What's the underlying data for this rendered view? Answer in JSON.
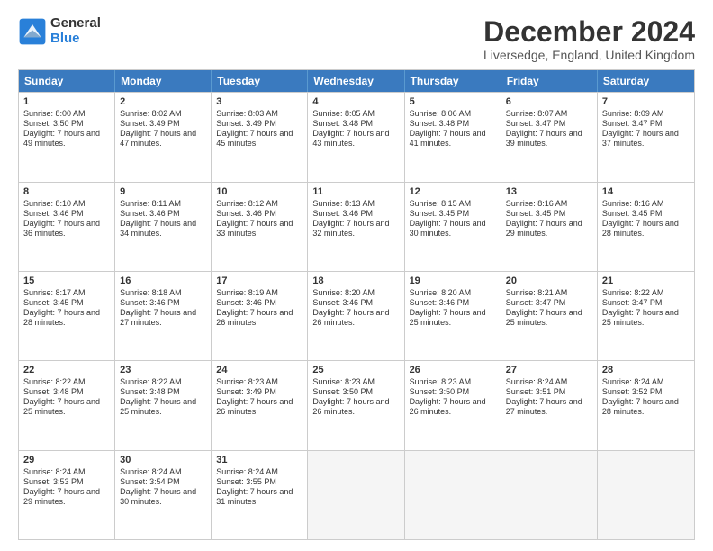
{
  "logo": {
    "general": "General",
    "blue": "Blue"
  },
  "title": "December 2024",
  "location": "Liversedge, England, United Kingdom",
  "weekdays": [
    "Sunday",
    "Monday",
    "Tuesday",
    "Wednesday",
    "Thursday",
    "Friday",
    "Saturday"
  ],
  "weeks": [
    [
      {
        "day": "1",
        "sunrise": "8:00 AM",
        "sunset": "3:50 PM",
        "daylight": "7 hours and 49 minutes."
      },
      {
        "day": "2",
        "sunrise": "8:02 AM",
        "sunset": "3:49 PM",
        "daylight": "7 hours and 47 minutes."
      },
      {
        "day": "3",
        "sunrise": "8:03 AM",
        "sunset": "3:49 PM",
        "daylight": "7 hours and 45 minutes."
      },
      {
        "day": "4",
        "sunrise": "8:05 AM",
        "sunset": "3:48 PM",
        "daylight": "7 hours and 43 minutes."
      },
      {
        "day": "5",
        "sunrise": "8:06 AM",
        "sunset": "3:48 PM",
        "daylight": "7 hours and 41 minutes."
      },
      {
        "day": "6",
        "sunrise": "8:07 AM",
        "sunset": "3:47 PM",
        "daylight": "7 hours and 39 minutes."
      },
      {
        "day": "7",
        "sunrise": "8:09 AM",
        "sunset": "3:47 PM",
        "daylight": "7 hours and 37 minutes."
      }
    ],
    [
      {
        "day": "8",
        "sunrise": "8:10 AM",
        "sunset": "3:46 PM",
        "daylight": "7 hours and 36 minutes."
      },
      {
        "day": "9",
        "sunrise": "8:11 AM",
        "sunset": "3:46 PM",
        "daylight": "7 hours and 34 minutes."
      },
      {
        "day": "10",
        "sunrise": "8:12 AM",
        "sunset": "3:46 PM",
        "daylight": "7 hours and 33 minutes."
      },
      {
        "day": "11",
        "sunrise": "8:13 AM",
        "sunset": "3:46 PM",
        "daylight": "7 hours and 32 minutes."
      },
      {
        "day": "12",
        "sunrise": "8:15 AM",
        "sunset": "3:45 PM",
        "daylight": "7 hours and 30 minutes."
      },
      {
        "day": "13",
        "sunrise": "8:16 AM",
        "sunset": "3:45 PM",
        "daylight": "7 hours and 29 minutes."
      },
      {
        "day": "14",
        "sunrise": "8:16 AM",
        "sunset": "3:45 PM",
        "daylight": "7 hours and 28 minutes."
      }
    ],
    [
      {
        "day": "15",
        "sunrise": "8:17 AM",
        "sunset": "3:45 PM",
        "daylight": "7 hours and 28 minutes."
      },
      {
        "day": "16",
        "sunrise": "8:18 AM",
        "sunset": "3:46 PM",
        "daylight": "7 hours and 27 minutes."
      },
      {
        "day": "17",
        "sunrise": "8:19 AM",
        "sunset": "3:46 PM",
        "daylight": "7 hours and 26 minutes."
      },
      {
        "day": "18",
        "sunrise": "8:20 AM",
        "sunset": "3:46 PM",
        "daylight": "7 hours and 26 minutes."
      },
      {
        "day": "19",
        "sunrise": "8:20 AM",
        "sunset": "3:46 PM",
        "daylight": "7 hours and 25 minutes."
      },
      {
        "day": "20",
        "sunrise": "8:21 AM",
        "sunset": "3:47 PM",
        "daylight": "7 hours and 25 minutes."
      },
      {
        "day": "21",
        "sunrise": "8:22 AM",
        "sunset": "3:47 PM",
        "daylight": "7 hours and 25 minutes."
      }
    ],
    [
      {
        "day": "22",
        "sunrise": "8:22 AM",
        "sunset": "3:48 PM",
        "daylight": "7 hours and 25 minutes."
      },
      {
        "day": "23",
        "sunrise": "8:22 AM",
        "sunset": "3:48 PM",
        "daylight": "7 hours and 25 minutes."
      },
      {
        "day": "24",
        "sunrise": "8:23 AM",
        "sunset": "3:49 PM",
        "daylight": "7 hours and 26 minutes."
      },
      {
        "day": "25",
        "sunrise": "8:23 AM",
        "sunset": "3:50 PM",
        "daylight": "7 hours and 26 minutes."
      },
      {
        "day": "26",
        "sunrise": "8:23 AM",
        "sunset": "3:50 PM",
        "daylight": "7 hours and 26 minutes."
      },
      {
        "day": "27",
        "sunrise": "8:24 AM",
        "sunset": "3:51 PM",
        "daylight": "7 hours and 27 minutes."
      },
      {
        "day": "28",
        "sunrise": "8:24 AM",
        "sunset": "3:52 PM",
        "daylight": "7 hours and 28 minutes."
      }
    ],
    [
      {
        "day": "29",
        "sunrise": "8:24 AM",
        "sunset": "3:53 PM",
        "daylight": "7 hours and 29 minutes."
      },
      {
        "day": "30",
        "sunrise": "8:24 AM",
        "sunset": "3:54 PM",
        "daylight": "7 hours and 30 minutes."
      },
      {
        "day": "31",
        "sunrise": "8:24 AM",
        "sunset": "3:55 PM",
        "daylight": "7 hours and 31 minutes."
      },
      {
        "day": "",
        "sunrise": "",
        "sunset": "",
        "daylight": ""
      },
      {
        "day": "",
        "sunrise": "",
        "sunset": "",
        "daylight": ""
      },
      {
        "day": "",
        "sunrise": "",
        "sunset": "",
        "daylight": ""
      },
      {
        "day": "",
        "sunrise": "",
        "sunset": "",
        "daylight": ""
      }
    ]
  ]
}
